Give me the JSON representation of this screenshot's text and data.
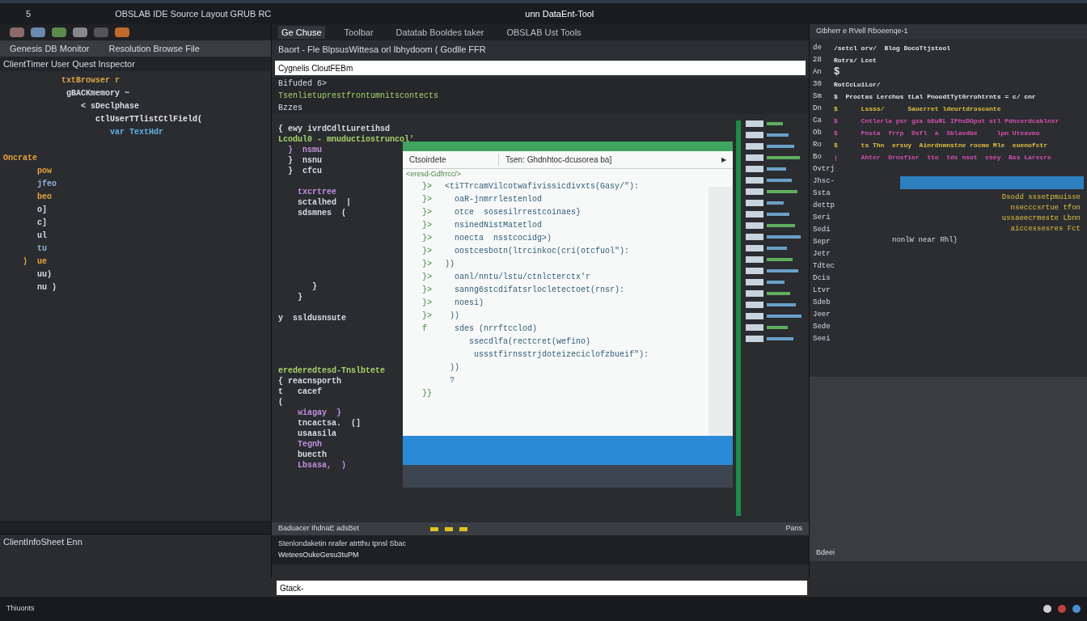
{
  "title_bar": {
    "number": "5",
    "app_title": "OBSLAB IDE  Source  Layout  GRUB RC",
    "document_title": "unn DataEnt-Tool"
  },
  "left_panel": {
    "header": [
      "Genesis DB Monitor",
      "Resolution Browse File"
    ],
    "tab": "ClientTimer User Quest Inspector",
    "code_lines": [
      {
        "kind": "code",
        "text": "            txtBrowser r",
        "color": "#d9a441"
      },
      {
        "kind": "code",
        "text": "             gBACKmemory ~",
        "color": "#d6dde6"
      },
      {
        "kind": "code",
        "text": "                < sDeclphase",
        "color": "#d6dde6"
      },
      {
        "kind": "code",
        "text": "                   ctlUserTTlistCtlField(",
        "color": "#e6e6e6"
      },
      {
        "kind": "code",
        "text": "                      var TextHdr",
        "color": "#5fb3e6"
      },
      {
        "kind": "blank"
      },
      {
        "kind": "code",
        "text": "Oncrate",
        "color": "#e8a33c"
      },
      {
        "kind": "code",
        "text": "       pow",
        "color": "#e8a33c"
      },
      {
        "kind": "code",
        "text": "       jfeo",
        "color": "#8fb7e0"
      },
      {
        "kind": "code",
        "text": "       beo",
        "color": "#e8a33c"
      },
      {
        "kind": "code",
        "text": "       o]",
        "color": "#d6dde6"
      },
      {
        "kind": "code",
        "text": "       c]",
        "color": "#d6dde6"
      },
      {
        "kind": "code",
        "text": "       ul",
        "color": "#d6dde6"
      },
      {
        "kind": "code",
        "text": "       tu",
        "color": "#8fb7e0"
      },
      {
        "kind": "code",
        "text": "    )  ue",
        "color": "#e8a33c"
      },
      {
        "kind": "code",
        "text": "       uu)",
        "color": "#d6dde6"
      },
      {
        "kind": "code",
        "text": "       nu )",
        "color": "#d6dde6"
      }
    ],
    "footer": "ClientInfoSheet Enn"
  },
  "middle_panel": {
    "tabs": [
      {
        "label": "Ge Chuse",
        "selected": true
      },
      {
        "label": "Toolbar",
        "selected": false
      },
      {
        "label": "Datatab Booldes taker",
        "selected": false
      },
      {
        "label": "OBSLAB Ust Tools",
        "selected": false
      }
    ],
    "path": "Baort - Fle  BlpsusWittesa orl Ibhydoom  ( Godlle FFR",
    "search": {
      "value": "Cygnelis CloutFEBm"
    },
    "info_lines": [
      "Bifuded 6>",
      "Tsenlietuprestfrontumnitscontects",
      "Bzzes"
    ],
    "code_lines": [
      {
        "kind": "code",
        "text": "{ ewy ivrdCdltLuretihsd",
        "color": "#d6dde6"
      },
      {
        "kind": "code",
        "text": "Lcodul0 - mnuductiostruncol'",
        "color": "#a9d26b"
      },
      {
        "kind": "code",
        "text": "  }  nsmu",
        "color": "#c28fe0"
      },
      {
        "kind": "code",
        "text": "  }  nsnu",
        "color": "#d6dde6"
      },
      {
        "kind": "code",
        "text": "  }  cfcu",
        "color": "#d6dde6"
      },
      {
        "kind": "blank"
      },
      {
        "kind": "code",
        "text": "    txcrtree",
        "color": "#c28fe0"
      },
      {
        "kind": "code",
        "text": "    sctalhed  |",
        "color": "#d6dde6"
      },
      {
        "kind": "code",
        "text": "    sdsmnes  (",
        "color": "#d6dde6"
      },
      {
        "kind": "blank"
      },
      {
        "kind": "blank"
      },
      {
        "kind": "blank"
      },
      {
        "kind": "blank"
      },
      {
        "kind": "blank"
      },
      {
        "kind": "blank"
      },
      {
        "kind": "code",
        "text": "       }",
        "color": "#d6dde6"
      },
      {
        "kind": "code",
        "text": "    }",
        "color": "#d6dde6"
      },
      {
        "kind": "blank"
      },
      {
        "kind": "code",
        "text": "y  ssldusnsute",
        "color": "#d6dde6"
      },
      {
        "kind": "blank"
      },
      {
        "kind": "blank"
      },
      {
        "kind": "blank"
      },
      {
        "kind": "blank"
      },
      {
        "kind": "code",
        "text": "erederedtesd-Tnslbtete",
        "color": "#a9d26b"
      },
      {
        "kind": "code",
        "text": "{ reacnsporth",
        "color": "#d6dde6"
      },
      {
        "kind": "code",
        "text": "t   cacef",
        "color": "#d6dde6"
      },
      {
        "kind": "code",
        "text": "(",
        "color": "#d6dde6"
      },
      {
        "kind": "code",
        "text": "    wiagay  }",
        "color": "#c28fe0"
      },
      {
        "kind": "code",
        "text": "    tncactsa.  (]",
        "color": "#d6dde6"
      },
      {
        "kind": "code",
        "text": "    usaasila",
        "color": "#d6dde6"
      },
      {
        "kind": "code",
        "text": "    Tegnh",
        "color": "#c28fe0"
      },
      {
        "kind": "code",
        "text": "    buecth",
        "color": "#d6dde6"
      },
      {
        "kind": "code",
        "text": "    Lbsasa,  )",
        "color": "#c28fe0"
      }
    ],
    "dialog": {
      "label": "Ctsoirdete",
      "field": "Tsen: Ghdnhtoc-dcusorea ba]",
      "run_glyph": "▶",
      "breadcrumb": "<eresd-Gdfrrcc/>",
      "lines": [
        {
          "mark": "}>",
          "text": "<tiTTrcamVilcotwafivissicdivxts(Gasy/\"):"
        },
        {
          "mark": "}>",
          "text": "  oaR-jnmrrlestenlod"
        },
        {
          "mark": "}>",
          "text": "  otce  sosesilrrestcoinaes}"
        },
        {
          "mark": "}>",
          "text": "  nsinedNistMatetlod"
        },
        {
          "mark": "}>",
          "text": "  noecta  nsstcocidg>)"
        },
        {
          "mark": "}>",
          "text": "  oostcesbotn(ltrcinkoc(cri(otcfuol\"):"
        },
        {
          "mark": "}>",
          "text": "))"
        },
        {
          "mark": "}>",
          "text": "  oanl/nntu/lstu/ctnlcterctx'r"
        },
        {
          "mark": "}>",
          "text": "  sanng6stcdifatsrlocletectoet(rnsr):"
        },
        {
          "mark": "}>",
          "text": "  noesi)"
        },
        {
          "mark": "}>",
          "text": " ))"
        },
        {
          "mark": "f",
          "text": "  sdes (nrrftcclod)"
        },
        {
          "text": "     ssecdlfa(rectcret(wefino)"
        },
        {
          "text": "      ussstfirnsstrjdoteizeciclofzbueif\"):"
        },
        {
          "text": " ))"
        },
        {
          "text": " ?"
        },
        {
          "mark": "}}"
        }
      ]
    },
    "footer": {
      "left": "Baduacer IhdnaE adsBet",
      "right": "Pans"
    },
    "console": {
      "tab": "Stenlondaketin nrafer atrtthu tpnsl Sbac",
      "line": "WeteesOukeGesu3tuPM"
    }
  },
  "command_input": {
    "value": "Gtack-"
  },
  "right_panel": {
    "header": "Gtbherr e  RVell Rboeenqe-1",
    "lines": [
      {
        "number": "de",
        "text": "/setcl orv/  Blog DocoTtjstool",
        "color": "#e6e6e6"
      },
      {
        "number": "28",
        "text": "Rotrs/ Lcet",
        "color": "#e6e6e6"
      },
      {
        "number": "An",
        "text": "$",
        "color": "#e6e6e6"
      },
      {
        "number": "30",
        "text": "RotCcLu1Lor/",
        "color": "#e6e6e6"
      },
      {
        "number": "Sm",
        "text": "$  Proctas Lerchus tLal PnoodtTytGrrohtrnts = c/ cnr",
        "color": "#e6e6e6"
      },
      {
        "number": "Dn",
        "text": "$      Lssss/      Sauerret ldeurtdrosconte",
        "color": "#e0c040"
      },
      {
        "number": "Ca",
        "text": "$      Cntlerla psr gza bEuRL IPhsDOput stl Pdncerdcaklnsr",
        "color": "#d64fb0"
      },
      {
        "number": "Ob",
        "text": "$      Pnsta  frrp  Dsfl  a  Sblavdbe     lpn Uteavmo",
        "color": "#d64fb0"
      },
      {
        "number": "Ro",
        "text": "$      ts Thn  ersuy  Ainrdnmnstne rocmo Mle  euenofctr",
        "color": "#e0c040"
      },
      {
        "number": "Bo",
        "text": "|      Ahter  Drnsfier  tto  tds nsot  esey  Bss Larecre",
        "color": "#d64fb0"
      }
    ],
    "side_lines": [
      "Ovtrj",
      "Jhsc-",
      "Ssta",
      "dettp",
      "Seri",
      "Sedi",
      "Sepr",
      "Jetr",
      "Tdtec",
      "Dcis",
      "Ltvr",
      "Sdeb",
      "Jeer",
      "Sede",
      "Seei"
    ],
    "selection_lines": [
      "Dsodd sssetpmuisse",
      "nsecccsrtue tfon",
      "ussaeecrmeste Lbnn",
      "aiccessesres Fct"
    ],
    "label": "nonlW  near  Rhl}",
    "lower_footer": "Bdeei"
  },
  "status_bar": {
    "text": "Thiuonts"
  }
}
